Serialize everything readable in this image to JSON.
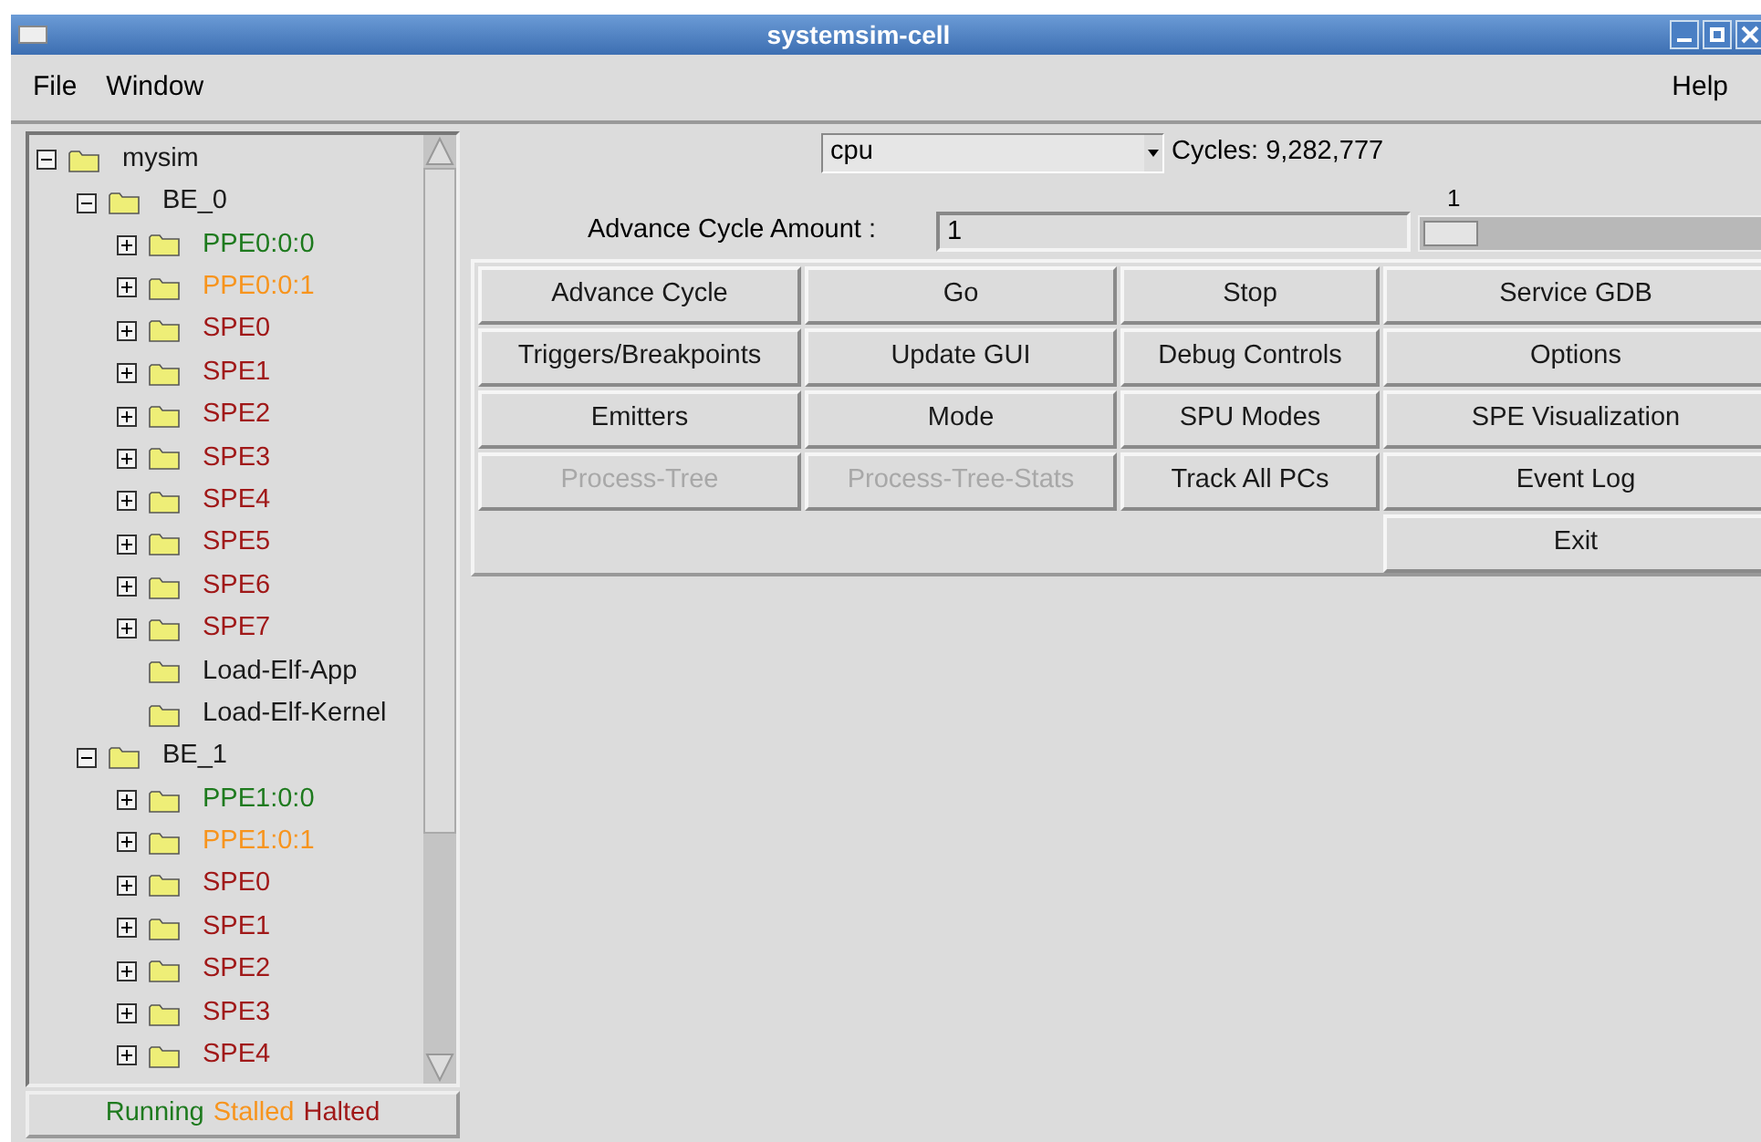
{
  "window": {
    "title": "systemsim-cell"
  },
  "menu": [
    {
      "label": "File"
    },
    {
      "label": "Window"
    }
  ],
  "help_menu": {
    "label": "Help"
  },
  "tree": [
    {
      "label": "mysim",
      "kind": "node",
      "expanded": true,
      "color": "#1a1a1a",
      "children": [
        {
          "label": "BE_0",
          "kind": "node",
          "expanded": true,
          "color": "#1a1a1a",
          "children": [
            {
              "label": "PPE0:0:0",
              "kind": "node",
              "expanded": false,
              "color": "#1e7a1e"
            },
            {
              "label": "PPE0:0:1",
              "kind": "node",
              "expanded": false,
              "color": "#f7941d"
            },
            {
              "label": "SPE0",
              "kind": "node",
              "expanded": false,
              "color": "#a01818"
            },
            {
              "label": "SPE1",
              "kind": "node",
              "expanded": false,
              "color": "#a01818"
            },
            {
              "label": "SPE2",
              "kind": "node",
              "expanded": false,
              "color": "#a01818"
            },
            {
              "label": "SPE3",
              "kind": "node",
              "expanded": false,
              "color": "#a01818"
            },
            {
              "label": "SPE4",
              "kind": "node",
              "expanded": false,
              "color": "#a01818"
            },
            {
              "label": "SPE5",
              "kind": "node",
              "expanded": false,
              "color": "#a01818"
            },
            {
              "label": "SPE6",
              "kind": "node",
              "expanded": false,
              "color": "#a01818"
            },
            {
              "label": "SPE7",
              "kind": "node",
              "expanded": false,
              "color": "#a01818"
            },
            {
              "label": "Load-Elf-App",
              "kind": "leaf",
              "color": "#1a1a1a"
            },
            {
              "label": "Load-Elf-Kernel",
              "kind": "leaf",
              "color": "#1a1a1a"
            }
          ]
        },
        {
          "label": "BE_1",
          "kind": "node",
          "expanded": true,
          "color": "#1a1a1a",
          "children": [
            {
              "label": "PPE1:0:0",
              "kind": "node",
              "expanded": false,
              "color": "#1e7a1e"
            },
            {
              "label": "PPE1:0:1",
              "kind": "node",
              "expanded": false,
              "color": "#f7941d"
            },
            {
              "label": "SPE0",
              "kind": "node",
              "expanded": false,
              "color": "#a01818"
            },
            {
              "label": "SPE1",
              "kind": "node",
              "expanded": false,
              "color": "#a01818"
            },
            {
              "label": "SPE2",
              "kind": "node",
              "expanded": false,
              "color": "#a01818"
            },
            {
              "label": "SPE3",
              "kind": "node",
              "expanded": false,
              "color": "#a01818"
            },
            {
              "label": "SPE4",
              "kind": "node",
              "expanded": false,
              "color": "#a01818"
            }
          ]
        }
      ]
    }
  ],
  "legend": [
    {
      "label": "Running",
      "color": "#1e7a1e"
    },
    {
      "label": "Stalled",
      "color": "#f7941d"
    },
    {
      "label": "Halted",
      "color": "#a01818"
    }
  ],
  "cpu_select": {
    "value": "cpu"
  },
  "cycles": "Cycles: 9,282,777",
  "advance": {
    "label": "Advance Cycle Amount :",
    "value": "1"
  },
  "slider": {
    "reading": "1",
    "level": 0
  },
  "buttons": [
    [
      {
        "label": "Advance Cycle",
        "disabled": false
      },
      {
        "label": "Go",
        "disabled": false
      },
      {
        "label": "Stop",
        "disabled": false
      },
      {
        "label": "Service GDB",
        "disabled": false
      }
    ],
    [
      {
        "label": "Triggers/Breakpoints",
        "disabled": false
      },
      {
        "label": "Update GUI",
        "disabled": false
      },
      {
        "label": "Debug Controls",
        "disabled": false
      },
      {
        "label": "Options",
        "disabled": false
      }
    ],
    [
      {
        "label": "Emitters",
        "disabled": false
      },
      {
        "label": "Mode",
        "disabled": false
      },
      {
        "label": "SPU Modes",
        "disabled": false
      },
      {
        "label": "SPE Visualization",
        "disabled": false
      }
    ],
    [
      {
        "label": "Process-Tree",
        "disabled": true
      },
      {
        "label": "Process-Tree-Stats",
        "disabled": true
      },
      {
        "label": "Track All PCs",
        "disabled": false
      },
      {
        "label": "Event Log",
        "disabled": false
      }
    ],
    [
      {
        "label": "Exit",
        "disabled": false
      }
    ]
  ]
}
